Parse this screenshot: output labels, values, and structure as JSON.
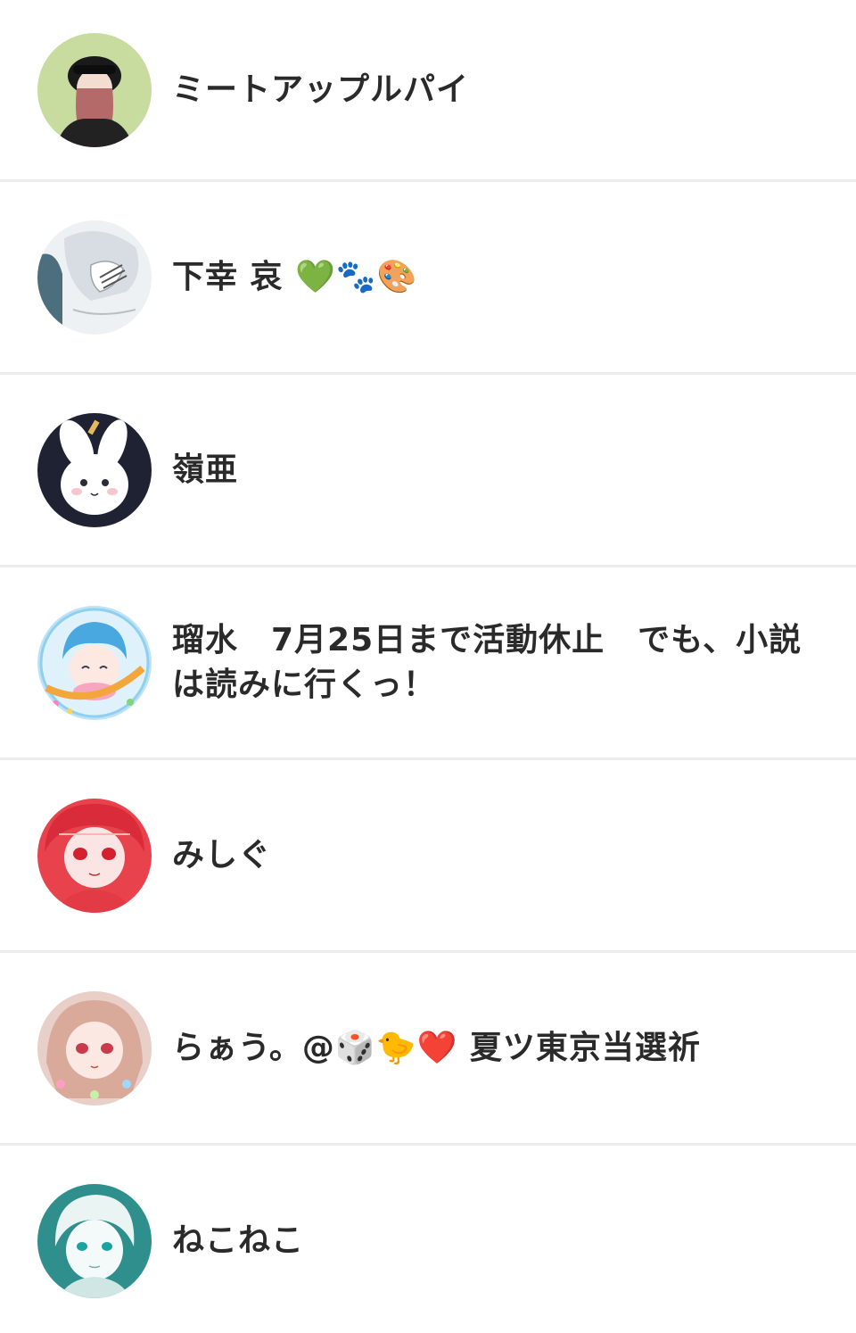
{
  "users": [
    {
      "name": "ミートアップルパイ",
      "avatar": "avatar-girl-black-beret",
      "bg": "#c9dca0"
    },
    {
      "name": "下幸 哀 💚🐾🎨",
      "avatar": "avatar-white-hair-sketch",
      "bg": "#dfe4e8"
    },
    {
      "name": "嶺亜",
      "avatar": "avatar-white-bunny",
      "bg": "#1e2233"
    },
    {
      "name": "瑠水　7月25日まで活動休止　でも、小説は読みに行くっ！",
      "avatar": "avatar-summer-tour-badge",
      "bg": "#bfe3f5"
    },
    {
      "name": "みしぐ",
      "avatar": "avatar-red-hair-girl",
      "bg": "#e8434c"
    },
    {
      "name": "らぁう。@🎲🐤❤️ 夏ツ東京当選祈",
      "avatar": "avatar-pink-hair-girl",
      "bg": "#e8cfc8"
    },
    {
      "name": "ねこねこ",
      "avatar": "avatar-teal-sketch",
      "bg": "#2f8f8c"
    }
  ]
}
